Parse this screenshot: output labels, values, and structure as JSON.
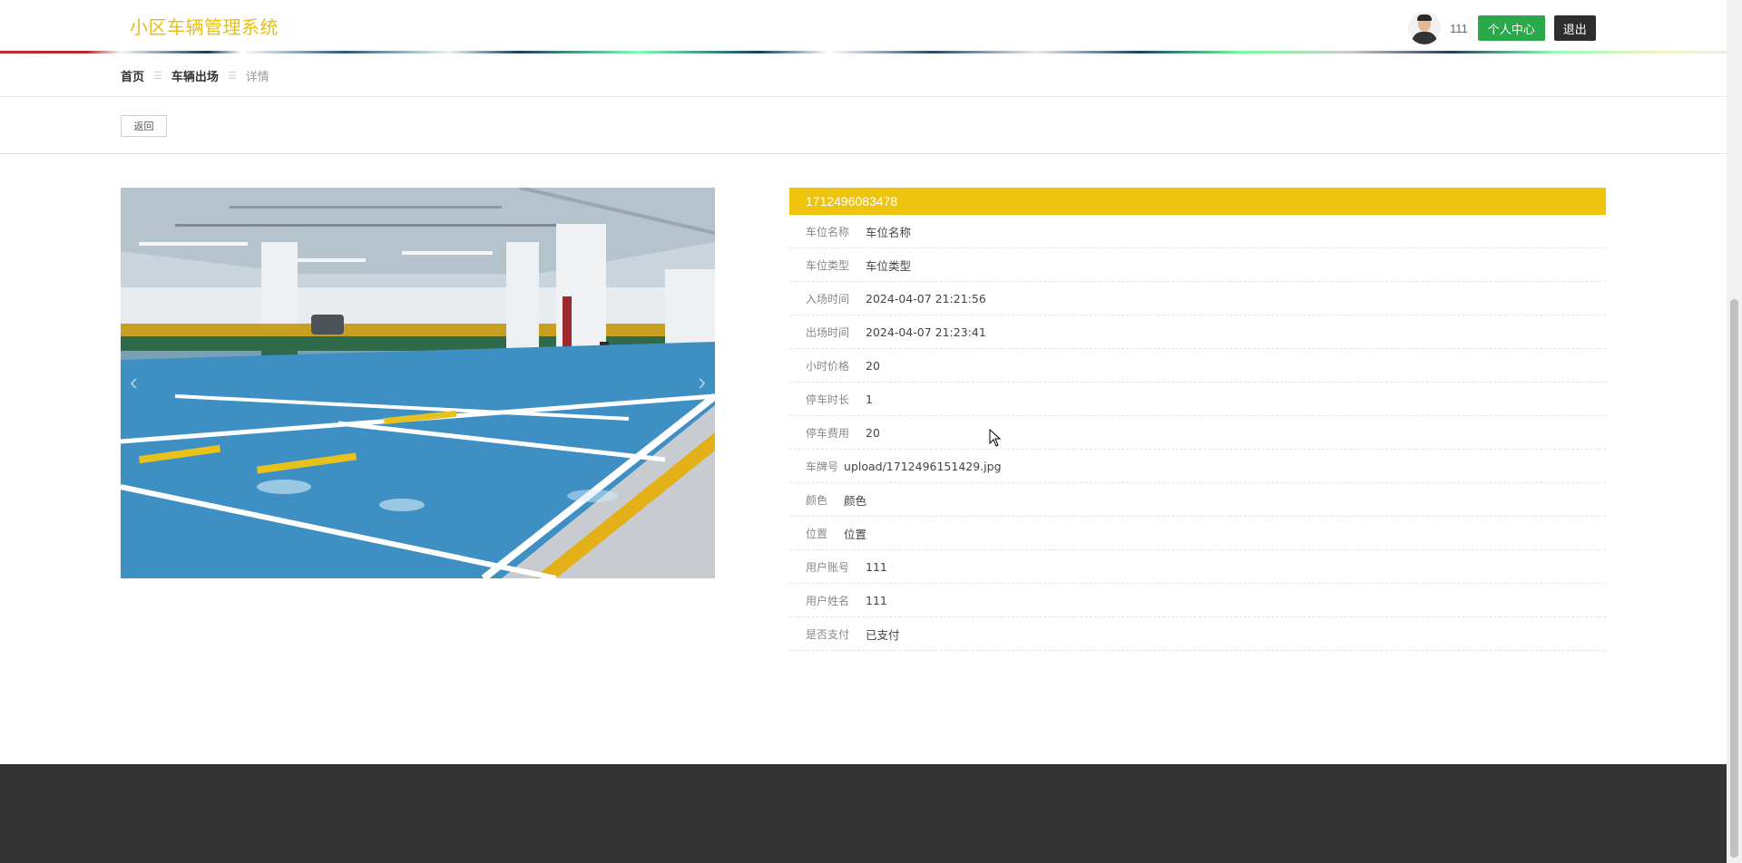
{
  "header": {
    "site_title": "小区车辆管理系统",
    "user_name": "111",
    "personal_center_label": "个人中心",
    "logout_label": "退出"
  },
  "breadcrumb": {
    "home": "首页",
    "section": "车辆出场",
    "current": "详情"
  },
  "back_label": "返回",
  "detail": {
    "title": "1712496083478",
    "rows": [
      {
        "label": "车位名称",
        "value": "车位名称"
      },
      {
        "label": "车位类型",
        "value": "车位类型"
      },
      {
        "label": "入场时间",
        "value": "2024-04-07 21:21:56"
      },
      {
        "label": "出场时间",
        "value": "2024-04-07 21:23:41"
      },
      {
        "label": "小时价格",
        "value": "20"
      },
      {
        "label": "停车时长",
        "value": "1"
      },
      {
        "label": "停车费用",
        "value": "20"
      },
      {
        "label": "车牌号",
        "value": "upload/1712496151429.jpg"
      },
      {
        "label": "颜色",
        "value": "颜色"
      },
      {
        "label": "位置",
        "value": "位置"
      },
      {
        "label": "用户账号",
        "value": "111"
      },
      {
        "label": "用户姓名",
        "value": "111"
      },
      {
        "label": "是否支付",
        "value": "已支付"
      }
    ]
  },
  "icons": {
    "carousel_prev": "chevron-left-icon",
    "carousel_next": "chevron-right-icon"
  },
  "colors": {
    "title_yellow": "#eec40e",
    "site_title": "#e8c010",
    "personal_center": "#2aa84a",
    "logout": "#2d2d2d",
    "footer": "#333333"
  }
}
